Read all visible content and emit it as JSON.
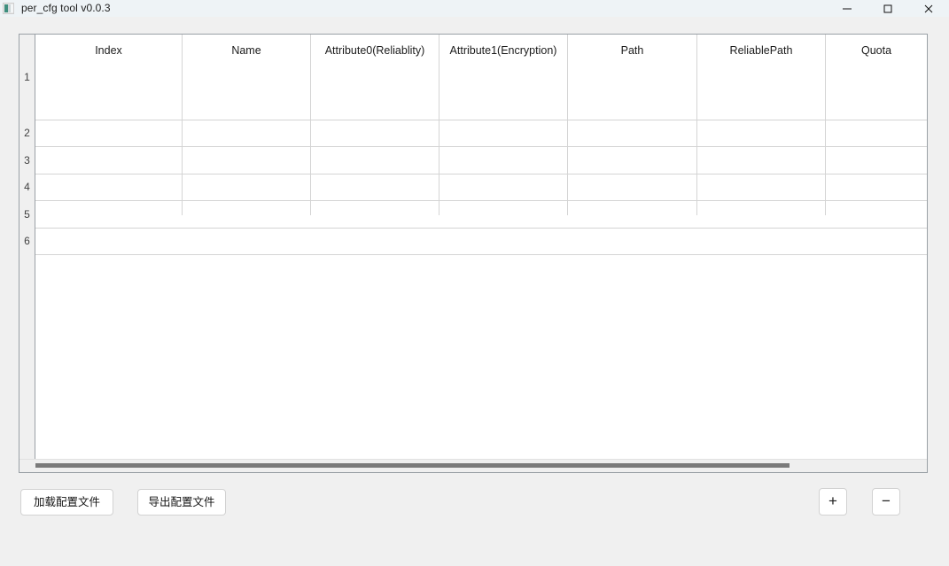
{
  "window": {
    "title": "per_cfg tool v0.0.3",
    "icon": "app-icon",
    "controls": [
      {
        "name": "minimize",
        "glyph": "minimize-icon"
      },
      {
        "name": "maximize",
        "glyph": "maximize-icon"
      },
      {
        "name": "close",
        "glyph": "close-icon"
      }
    ]
  },
  "table": {
    "columns": [
      {
        "label": "Index"
      },
      {
        "label": "Name"
      },
      {
        "label": "Attribute0(Reliablity)"
      },
      {
        "label": "Attribute1(Encryption)"
      },
      {
        "label": "Path"
      },
      {
        "label": "ReliablePath"
      },
      {
        "label": "Quota"
      }
    ],
    "row_numbers": [
      "1",
      "2",
      "3",
      "4",
      "5",
      "6"
    ],
    "rows": [
      {
        "Index": "",
        "Name": "",
        "Attribute0(Reliablity)": "",
        "Attribute1(Encryption)": "",
        "Path": "",
        "ReliablePath": "",
        "Quota": ""
      },
      {
        "Index": "",
        "Name": "",
        "Attribute0(Reliablity)": "",
        "Attribute1(Encryption)": "",
        "Path": "",
        "ReliablePath": "",
        "Quota": ""
      },
      {
        "Index": "",
        "Name": "",
        "Attribute0(Reliablity)": "",
        "Attribute1(Encryption)": "",
        "Path": "",
        "ReliablePath": "",
        "Quota": ""
      },
      {
        "Index": "",
        "Name": "",
        "Attribute0(Reliablity)": "",
        "Attribute1(Encryption)": "",
        "Path": "",
        "ReliablePath": "",
        "Quota": ""
      },
      {
        "Index": "",
        "Name": "",
        "Attribute0(Reliablity)": "",
        "Attribute1(Encryption)": "",
        "Path": "",
        "ReliablePath": "",
        "Quota": ""
      },
      {
        "Index": "",
        "Name": "",
        "Attribute0(Reliablity)": "",
        "Attribute1(Encryption)": "",
        "Path": "",
        "ReliablePath": "",
        "Quota": ""
      }
    ],
    "scrollbar": {
      "orientation": "horizontal",
      "thumb_fraction": 0.85
    }
  },
  "toolbar": {
    "load_label": "加载配置文件",
    "export_label": "导出配置文件",
    "add_label": "+",
    "remove_label": "−"
  },
  "colors": {
    "titlebar_bg": "#eef3f6",
    "window_bg": "#f0f0f0",
    "table_bg": "#ffffff",
    "grid_line": "#d4d4d4",
    "frame_border": "#9aa0a6",
    "scroll_thumb": "#7a7a7a",
    "text": "#1b1b1b"
  }
}
